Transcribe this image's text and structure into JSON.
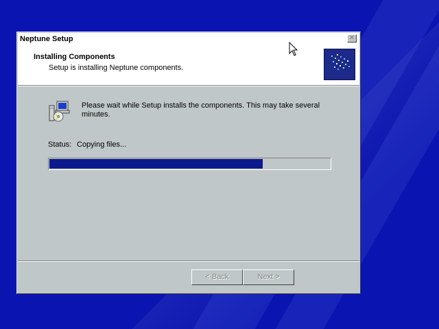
{
  "window": {
    "title": "Neptune Setup",
    "close_label": "✕"
  },
  "header": {
    "title": "Installing Components",
    "subtitle": "Setup is installing Neptune components."
  },
  "body": {
    "message": "Please wait while Setup installs the components.  This may take several minutes.",
    "status_label": "Status:",
    "status_value": "Copying files...",
    "progress_fraction": 0.76
  },
  "buttons": {
    "back_label": "< Back",
    "next_label": "Next >"
  },
  "icons": {
    "setup_icon": "computer-with-cd-icon",
    "logo": "neptune-logo-icon",
    "close": "close-icon",
    "cursor": "mouse-pointer-icon"
  },
  "colors": {
    "desktop": "#0a14b0",
    "progress_fill": "#0b1a8c",
    "window_face": "#c0c7c8"
  }
}
